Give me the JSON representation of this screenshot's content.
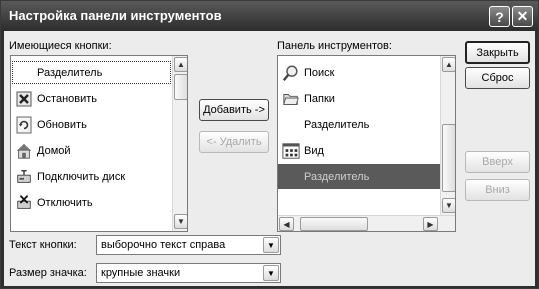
{
  "window": {
    "title": "Настройка панели инструментов",
    "help_glyph": "?",
    "close_glyph": "✕"
  },
  "available": {
    "label": "Имеющиеся кнопки:",
    "items": [
      {
        "label": "Разделитель",
        "icon": "none"
      },
      {
        "label": "Остановить",
        "icon": "stop-icon"
      },
      {
        "label": "Обновить",
        "icon": "refresh-icon"
      },
      {
        "label": "Домой",
        "icon": "home-icon"
      },
      {
        "label": "Подключить диск",
        "icon": "map-drive-icon"
      },
      {
        "label": "Отключить",
        "icon": "disconnect-icon"
      }
    ]
  },
  "middle": {
    "add_label": "Добавить ->",
    "remove_label": "<- Удалить"
  },
  "toolbar": {
    "label": "Панель инструментов:",
    "items": [
      {
        "label": "Поиск",
        "icon": "search-icon"
      },
      {
        "label": "Папки",
        "icon": "folders-icon"
      },
      {
        "label": "Разделитель",
        "icon": "none"
      },
      {
        "label": "Вид",
        "icon": "view-icon"
      },
      {
        "label": "Разделитель",
        "icon": "none",
        "selected": true
      }
    ]
  },
  "right": {
    "close_label": "Закрыть",
    "reset_label": "Сброс",
    "up_label": "Вверх",
    "down_label": "Вниз"
  },
  "options": {
    "text_label": "Текст кнопки:",
    "text_value": "выборочно текст справа",
    "size_label": "Размер значка:",
    "size_value": "крупные значки"
  }
}
